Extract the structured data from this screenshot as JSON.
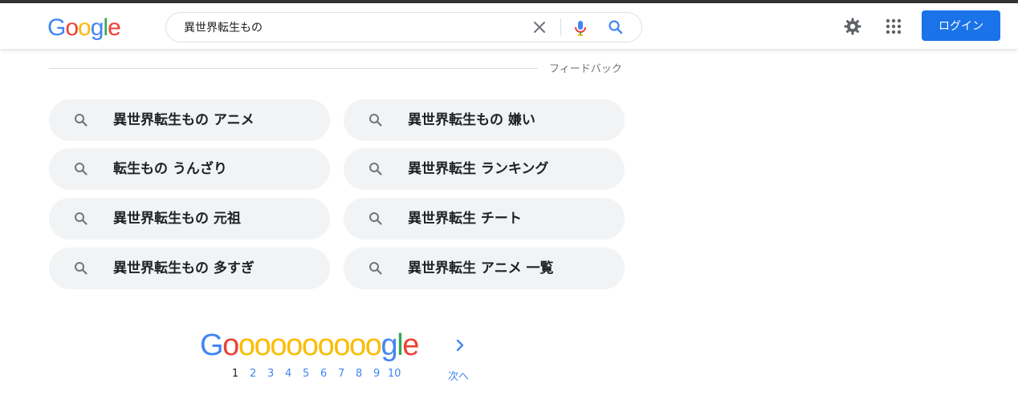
{
  "header": {
    "logo": [
      {
        "ch": "G",
        "color": "#4285F4"
      },
      {
        "ch": "o",
        "color": "#EA4335"
      },
      {
        "ch": "o",
        "color": "#FBBC05"
      },
      {
        "ch": "g",
        "color": "#4285F4"
      },
      {
        "ch": "l",
        "color": "#34A853"
      },
      {
        "ch": "e",
        "color": "#EA4335"
      }
    ],
    "search_value": "異世界転生もの",
    "login_label": "ログイン"
  },
  "feedback_label": "フィードバック",
  "related_searches": [
    "異世界転生もの アニメ",
    "異世界転生もの 嫌い",
    "転生もの うんざり",
    "異世界転生 ランキング",
    "異世界転生もの 元祖",
    "異世界転生 チート",
    "異世界転生もの 多すぎ",
    "異世界転生 アニメ 一覧"
  ],
  "pagination": {
    "logo_letters": [
      {
        "ch": "G",
        "color": "#4285F4"
      },
      {
        "ch": "o",
        "color": "#EA4335"
      },
      {
        "ch": "o",
        "color": "#FBBC05"
      },
      {
        "ch": "o",
        "color": "#FBBC05"
      },
      {
        "ch": "o",
        "color": "#FBBC05"
      },
      {
        "ch": "o",
        "color": "#FBBC05"
      },
      {
        "ch": "o",
        "color": "#FBBC05"
      },
      {
        "ch": "o",
        "color": "#FBBC05"
      },
      {
        "ch": "o",
        "color": "#FBBC05"
      },
      {
        "ch": "o",
        "color": "#FBBC05"
      },
      {
        "ch": "o",
        "color": "#FBBC05"
      },
      {
        "ch": "g",
        "color": "#4285F4"
      },
      {
        "ch": "l",
        "color": "#34A853"
      },
      {
        "ch": "e",
        "color": "#EA4335"
      }
    ],
    "current": "1",
    "pages": [
      "2",
      "3",
      "4",
      "5",
      "6",
      "7",
      "8",
      "9",
      "10"
    ],
    "next_label": "次へ"
  },
  "colors": {
    "accent": "#1a73e8",
    "chip_bg": "#f1f3f4"
  }
}
